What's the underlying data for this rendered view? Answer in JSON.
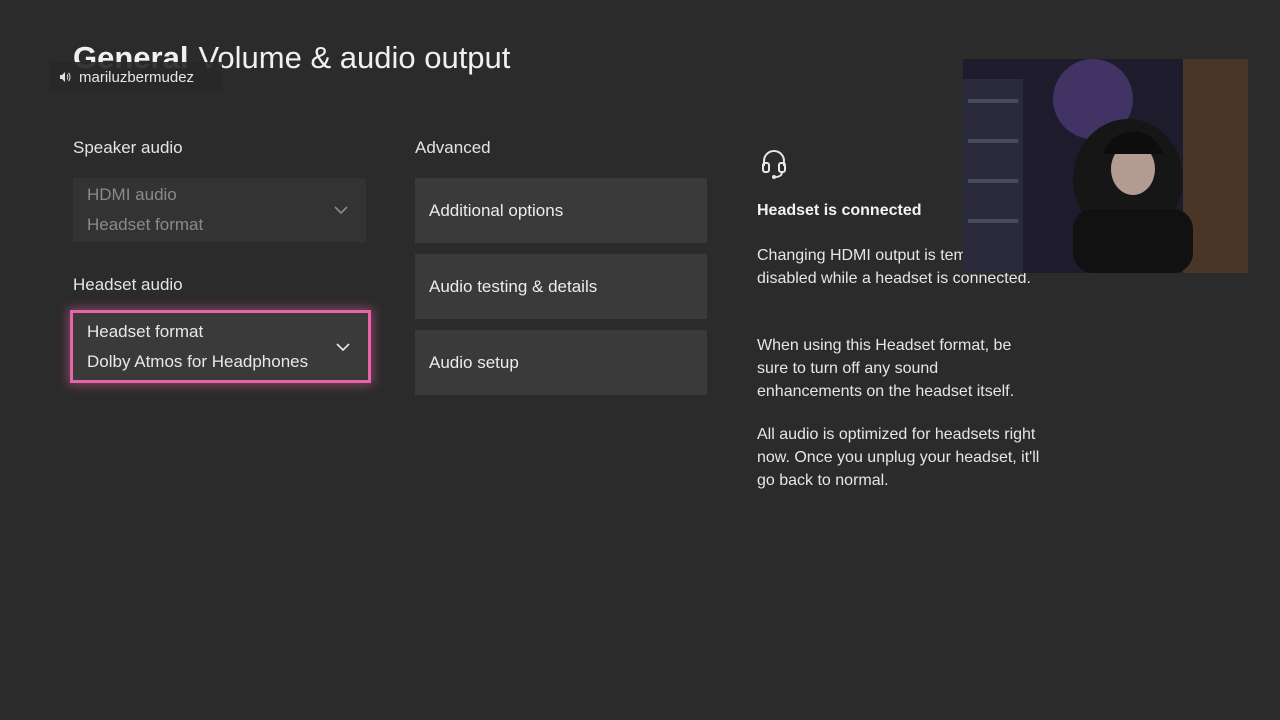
{
  "header": {
    "crumb": "General",
    "page_title": "Volume & audio output"
  },
  "streamer": {
    "name": "mariluzbermudez",
    "icon": "speaker-icon"
  },
  "speaker_audio": {
    "label": "Speaker audio",
    "dropdown": {
      "line1": "HDMI audio",
      "line2": "Headset format",
      "disabled": true
    }
  },
  "headset_audio": {
    "label": "Headset audio",
    "dropdown": {
      "line1": "Headset format",
      "line2": "Dolby Atmos for Headphones",
      "focused": true
    }
  },
  "advanced": {
    "label": "Advanced",
    "buttons": [
      "Additional options",
      "Audio testing & details",
      "Audio setup"
    ]
  },
  "info": {
    "icon": "headset-icon",
    "title": "Headset is connected",
    "paragraphs": [
      "Changing HDMI output is temporarily disabled while a headset is connected.",
      "When using this Headset format, be sure to turn off any sound enhancements on the headset itself.",
      "All audio is optimized for headsets right now. Once you unplug your headset, it'll go back to normal."
    ]
  },
  "colors": {
    "background": "#2b2b2b",
    "focus_ring": "#e765a6",
    "tile": "#3a3a3a"
  }
}
